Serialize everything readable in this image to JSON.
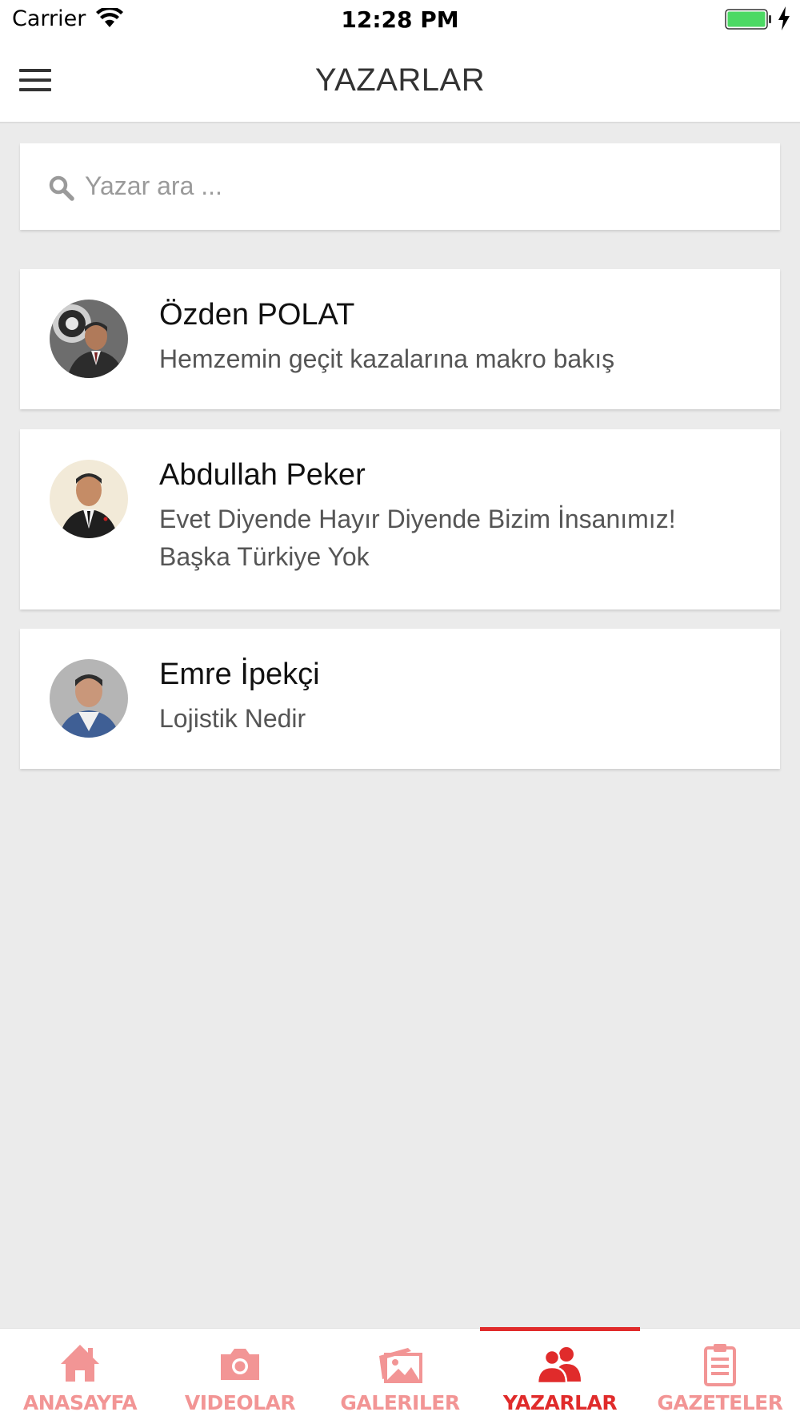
{
  "status_bar": {
    "carrier": "Carrier",
    "time": "12:28 PM"
  },
  "header": {
    "title": "YAZARLAR",
    "menu_icon": "hamburger-icon"
  },
  "search": {
    "placeholder": "Yazar ara ...",
    "value": "",
    "icon": "search-icon"
  },
  "authors": [
    {
      "name": "Özden POLAT",
      "article": "Hemzemin geçit kazalarına makro bakış"
    },
    {
      "name": "Abdullah Peker",
      "article": "Evet Diyende Hayır Diyende Bizim İnsanımız! Başka Türkiye Yok"
    },
    {
      "name": "Emre İpekçi",
      "article": "Lojistik Nedir"
    }
  ],
  "tabs": [
    {
      "label": "ANASAYFA",
      "icon": "home-icon",
      "active": false
    },
    {
      "label": "VIDEOLAR",
      "icon": "camera-icon",
      "active": false
    },
    {
      "label": "GALERILER",
      "icon": "gallery-icon",
      "active": false
    },
    {
      "label": "YAZARLAR",
      "icon": "authors-icon",
      "active": true
    },
    {
      "label": "GAZETELER",
      "icon": "clipboard-icon",
      "active": false
    }
  ],
  "colors": {
    "accent": "#e02b2b",
    "inactive_tab": "#f29595",
    "background": "#ebebeb",
    "battery": "#4cd964"
  }
}
